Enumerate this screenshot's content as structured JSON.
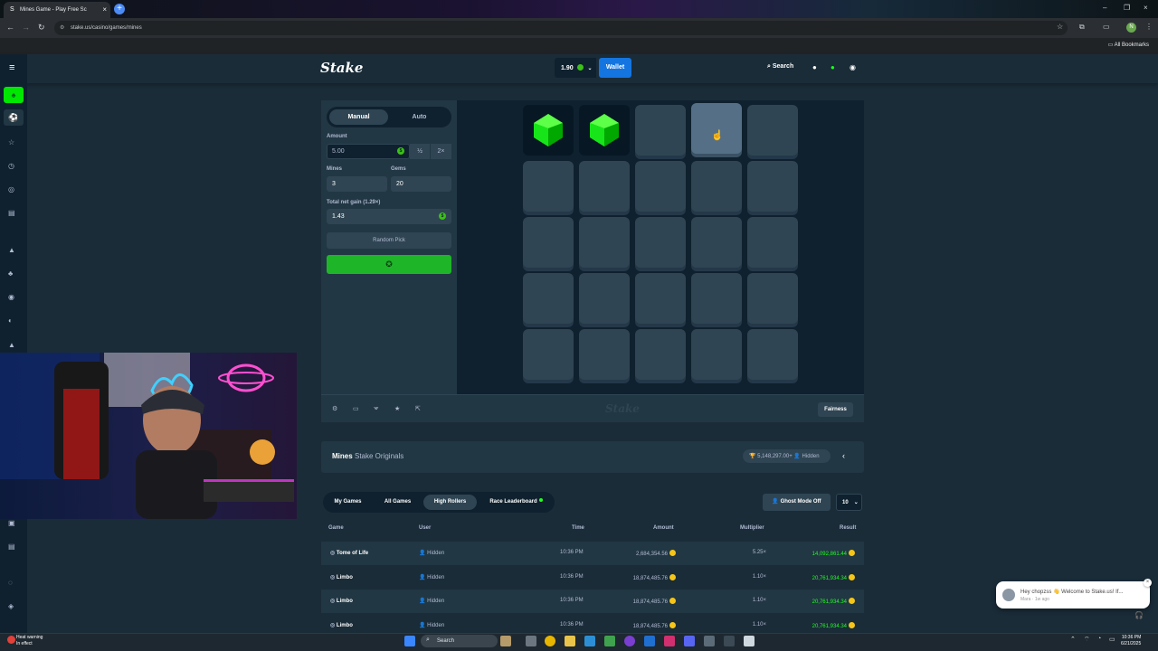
{
  "browser": {
    "tab_title": "Mines Game - Play Free Sc",
    "tab_favicon": "S",
    "url": "stake.us/casino/games/mines",
    "bookmarks": "All Bookmarks",
    "profile_initial": "N"
  },
  "header": {
    "logo": "Stake",
    "balance": "1.90",
    "wallet_label": "Wallet",
    "search_label": "Search"
  },
  "bet_panel": {
    "manual_label": "Manual",
    "auto_label": "Auto",
    "amount_label": "Amount",
    "amount_value": "5.00",
    "half_label": "½",
    "double_label": "2×",
    "mines_label": "Mines",
    "mines_value": "3",
    "gems_label": "Gems",
    "gems_value": "20",
    "net_gain_label": "Total net gain (1.29×)",
    "net_gain_value": "1.43",
    "random_pick_label": "Random Pick",
    "coin_symbol": "$"
  },
  "board": {
    "grid": [
      [
        "gem",
        "gem",
        "hidden",
        "hover",
        "hidden"
      ],
      [
        "hidden",
        "hidden",
        "hidden",
        "hidden",
        "hidden"
      ],
      [
        "hidden",
        "hidden",
        "hidden",
        "hidden",
        "hidden"
      ],
      [
        "hidden",
        "hidden",
        "hidden",
        "hidden",
        "hidden"
      ],
      [
        "hidden",
        "hidden",
        "hidden",
        "hidden",
        "hidden"
      ]
    ],
    "watermark": "Stake",
    "fairness_label": "Fairness"
  },
  "info": {
    "game_name": "Mines",
    "game_subtitle": "Stake Originals",
    "record_amount": "5,148,297.00+",
    "record_user": "Hidden"
  },
  "bets_table": {
    "tabs": [
      {
        "label": "My Games",
        "active": false
      },
      {
        "label": "All Games",
        "active": false
      },
      {
        "label": "High Rollers",
        "active": true
      },
      {
        "label": "Race Leaderboard",
        "active": false
      }
    ],
    "ghost_mode_label": "Ghost Mode Off",
    "row_count": "10",
    "columns": [
      "Game",
      "User",
      "Time",
      "Amount",
      "Multiplier",
      "Result"
    ],
    "rows": [
      {
        "game": "Tome of Life",
        "user": "Hidden",
        "time": "10:36 PM",
        "amount": "2,684,354.56",
        "multiplier": "5.25×",
        "result": "14,092,861.44"
      },
      {
        "game": "Limbo",
        "user": "Hidden",
        "time": "10:36 PM",
        "amount": "18,874,485.76",
        "multiplier": "1.10×",
        "result": "20,761,934.34"
      },
      {
        "game": "Limbo",
        "user": "Hidden",
        "time": "10:36 PM",
        "amount": "18,874,485.76",
        "multiplier": "1.10×",
        "result": "20,761,934.34"
      },
      {
        "game": "Limbo",
        "user": "Hidden",
        "time": "10:36 PM",
        "amount": "18,874,485.76",
        "multiplier": "1.10×",
        "result": "20,761,934.34"
      }
    ]
  },
  "chat_toast": {
    "message": "Hey chopzss 👋 Welcome to Stake.us! If...",
    "meta": "Mara · 1w ago"
  },
  "taskbar": {
    "weather_line1": "Heat warning",
    "weather_line2": "In effect",
    "search_placeholder": "Search",
    "time": "10:36 PM",
    "date": "6/21/2025"
  },
  "colors": {
    "accent_green": "#00e701",
    "wallet_blue": "#1475e1",
    "bg": "#1a2c38",
    "panel": "#213743",
    "tile": "#2f4553",
    "gem": "#1fff20"
  }
}
